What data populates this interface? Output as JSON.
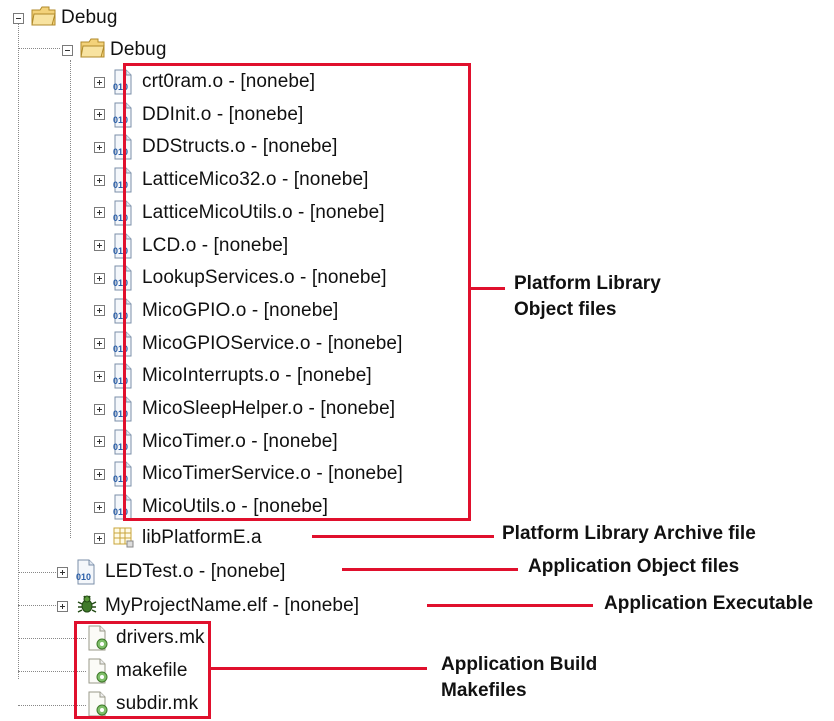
{
  "tree": {
    "root": {
      "label": "Debug"
    },
    "folder": {
      "label": "Debug"
    },
    "object_files": [
      "crt0ram.o - [nonebe]",
      "DDInit.o - [nonebe]",
      "DDStructs.o - [nonebe]",
      "LatticeMico32.o - [nonebe]",
      "LatticeMicoUtils.o - [nonebe]",
      "LCD.o - [nonebe]",
      "LookupServices.o - [nonebe]",
      "MicoGPIO.o - [nonebe]",
      "MicoGPIOService.o - [nonebe]",
      "MicoInterrupts.o - [nonebe]",
      "MicoSleepHelper.o - [nonebe]",
      "MicoTimer.o - [nonebe]",
      "MicoTimerService.o - [nonebe]",
      "MicoUtils.o - [nonebe]"
    ],
    "archive": {
      "label": "libPlatformE.a"
    },
    "app_object": {
      "label": "LEDTest.o - [nonebe]"
    },
    "executable": {
      "label": "MyProjectName.elf - [nonebe]"
    },
    "makefiles": [
      "drivers.mk",
      "makefile",
      "subdir.mk"
    ]
  },
  "annotations": {
    "platform_objects": {
      "line1": "Platform Library",
      "line2": "Object  files"
    },
    "archive": "Platform Library Archive file",
    "app_objects": "Application Object files",
    "executable": "Application Executable",
    "makefiles": {
      "line1": "Application Build",
      "line2": "Makefiles"
    }
  },
  "colors": {
    "highlight": "#e0102d",
    "folder": "#f3d27a",
    "binary_icon": "#2a5ea8"
  },
  "icons": {
    "folder": "folder-icon",
    "object": "binary-object-icon",
    "archive": "archive-grid-icon",
    "executable": "executable-bug-icon",
    "makefile": "makefile-icon"
  }
}
